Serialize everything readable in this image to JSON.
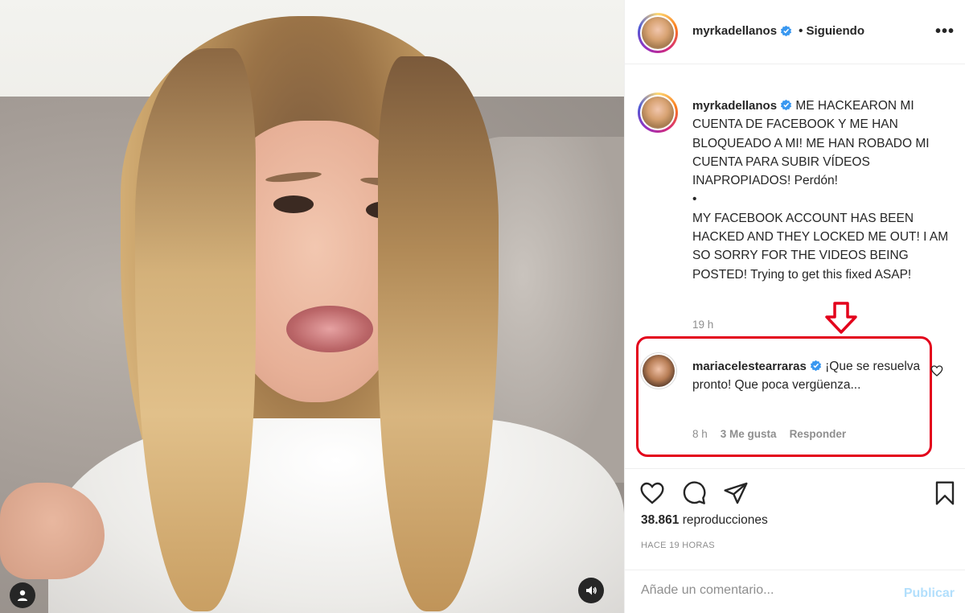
{
  "post": {
    "username": "myrkadellanos",
    "follow_separator": "•",
    "follow_status": "Siguiendo",
    "more_label": "•••",
    "caption": "ME HACKEARON MI CUENTA DE FACEBOOK Y ME HAN BLOQUEADO A MI! ME HAN ROBADO MI CUENTA PARA SUBIR VÍDEOS INAPROPIADOS! Perdón!\n•\nMY FACEBOOK ACCOUNT HAS BEEN HACKED AND THEY LOCKED ME OUT! I AM SO SORRY FOR THE VIDEOS BEING POSTED! Trying to get this fixed ASAP!",
    "caption_time": "19 h"
  },
  "comment": {
    "username": "mariacelestearraras",
    "text": "¡Que se resuelva pronto! Que poca vergüenza...",
    "time": "8 h",
    "likes": "3 Me gusta",
    "reply_label": "Responder"
  },
  "stats": {
    "views_count": "38.861",
    "views_label": "reproducciones",
    "posted_ago": "HACE 19 HORAS"
  },
  "composer": {
    "placeholder": "Añade un comentario...",
    "publish_label": "Publicar"
  },
  "icons": {
    "verified": "verified-badge-icon",
    "like": "heart-icon",
    "comment": "comment-bubble-icon",
    "share": "paper-plane-icon",
    "save": "bookmark-icon",
    "user": "user-icon",
    "audio": "speaker-icon",
    "annotation_arrow": "down-arrow-icon"
  },
  "colors": {
    "verified_blue": "#3897f0",
    "highlight_red": "#e3001b",
    "publish_disabled": "#b2dffc",
    "muted_text": "#8e8e8e"
  }
}
